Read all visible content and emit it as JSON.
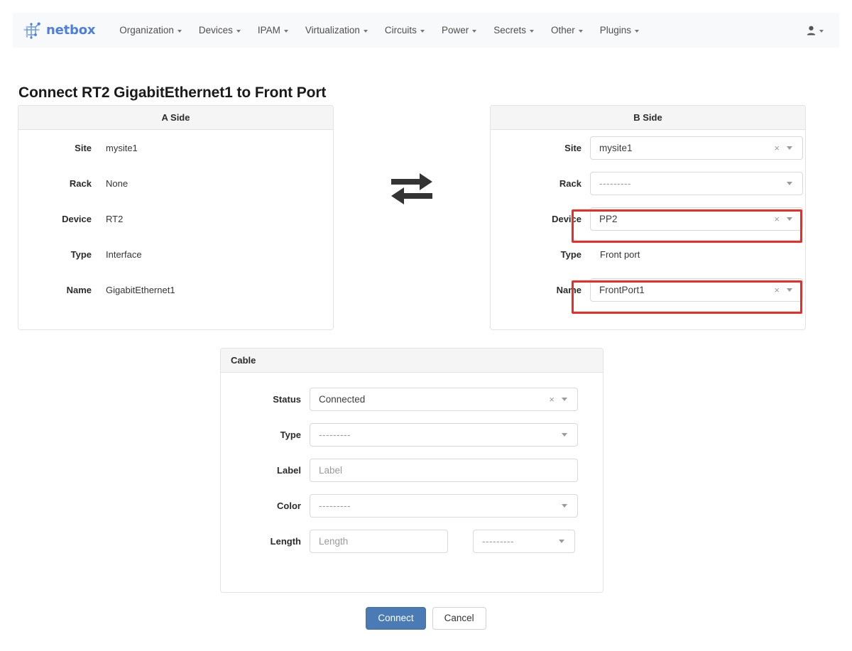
{
  "navbar": {
    "brand": "netbox",
    "brand_color": "#4c7fe0",
    "items": [
      {
        "label": "Organization"
      },
      {
        "label": "Devices"
      },
      {
        "label": "IPAM"
      },
      {
        "label": "Virtualization"
      },
      {
        "label": "Circuits"
      },
      {
        "label": "Power"
      },
      {
        "label": "Secrets"
      },
      {
        "label": "Other"
      },
      {
        "label": "Plugins"
      }
    ],
    "user_menu": {
      "label": ""
    }
  },
  "page": {
    "title": "Connect RT2 GigabitEthernet1 to Front Port"
  },
  "a_side": {
    "heading": "A Side",
    "rows": [
      {
        "label": "Site",
        "value": "mysite1"
      },
      {
        "label": "Rack",
        "value": "None"
      },
      {
        "label": "Device",
        "value": "RT2"
      },
      {
        "label": "Type",
        "value": "Interface"
      },
      {
        "label": "Name",
        "value": "GigabitEthernet1"
      }
    ]
  },
  "b_side": {
    "heading": "B Side",
    "site": {
      "label": "Site",
      "value": "mysite1",
      "clear": "×",
      "highlighted": false
    },
    "rack": {
      "label": "Rack",
      "value": "---------",
      "placeholder": true,
      "highlighted": false
    },
    "device": {
      "label": "Device",
      "value": "PP2",
      "clear": "×",
      "highlighted": true
    },
    "type": {
      "label": "Type",
      "value": "Front port"
    },
    "name": {
      "label": "Name",
      "value": "FrontPort1",
      "clear": "×",
      "highlighted": true
    }
  },
  "cable": {
    "heading": "Cable",
    "status": {
      "label": "Status",
      "value": "Connected",
      "clear": "×"
    },
    "type": {
      "label": "Type",
      "value": "---------"
    },
    "label": {
      "label": "Label",
      "value": "",
      "placeholder": "Label"
    },
    "color": {
      "label": "Color",
      "value": "---------"
    },
    "length": {
      "label": "Length",
      "value": "",
      "placeholder": "Length",
      "unit_value": "---------"
    }
  },
  "actions": {
    "connect": "Connect",
    "cancel": "Cancel",
    "primary_color": "#4a7bb5"
  },
  "annotations": {
    "highlight_color": "#ee2b24",
    "boxes": [
      "device-field",
      "name-field"
    ]
  },
  "icons": {
    "swap": "swap-horizontal-arrows-icon",
    "user": "user-icon",
    "caret": "chevron-down-icon",
    "clear": "clear-x-icon"
  }
}
